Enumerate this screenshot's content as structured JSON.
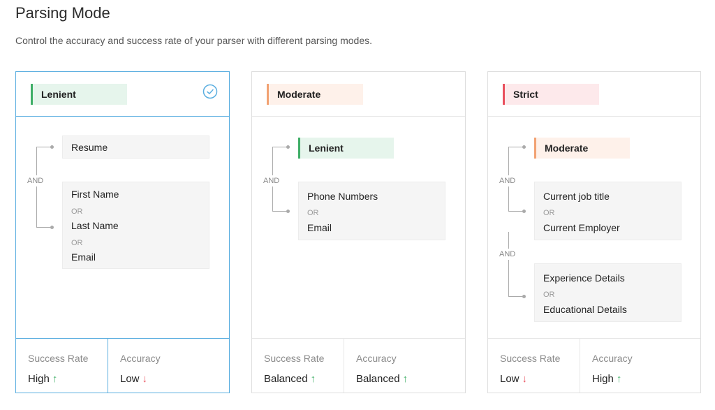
{
  "header": {
    "title": "Parsing Mode",
    "description": "Control the accuracy and success rate of your parser with different parsing modes."
  },
  "cards": [
    {
      "tag": "Lenient",
      "selected": true,
      "rules": {
        "first": "Resume",
        "and": "AND",
        "group": {
          "line1": "First Name",
          "or1": "OR",
          "line2": "Last Name",
          "or2": "OR",
          "line3": "Email"
        }
      },
      "footer": {
        "success_label": "Success Rate",
        "success_value": "High",
        "success_arrow": "↑",
        "accuracy_label": "Accuracy",
        "accuracy_value": "Low",
        "accuracy_arrow": "↓"
      }
    },
    {
      "tag": "Moderate",
      "selected": false,
      "rules": {
        "first": "Lenient",
        "and": "AND",
        "group": {
          "line1": "Phone Numbers",
          "or1": "OR",
          "line2": "Email"
        }
      },
      "footer": {
        "success_label": "Success Rate",
        "success_value": "Balanced",
        "success_arrow": "↑",
        "accuracy_label": "Accuracy",
        "accuracy_value": "Balanced",
        "accuracy_arrow": "↑"
      }
    },
    {
      "tag": "Strict",
      "selected": false,
      "rules": {
        "first": "Moderate",
        "and1": "AND",
        "group1": {
          "line1": "Current job title",
          "or1": "OR",
          "line2": "Current Employer"
        },
        "and2": "AND",
        "group2": {
          "line1": "Experience Details",
          "or1": "OR",
          "line2": "Educational Details"
        }
      },
      "footer": {
        "success_label": "Success Rate",
        "success_value": "Low",
        "success_arrow": "↓",
        "accuracy_label": "Accuracy",
        "accuracy_value": "High",
        "accuracy_arrow": "↑"
      }
    }
  ],
  "colors": {
    "selected_border": "#5aaee0",
    "lenient": "#3fae67",
    "moderate": "#f2a273",
    "strict": "#e9505d"
  },
  "icons": {
    "selected": "check-circle-icon"
  }
}
